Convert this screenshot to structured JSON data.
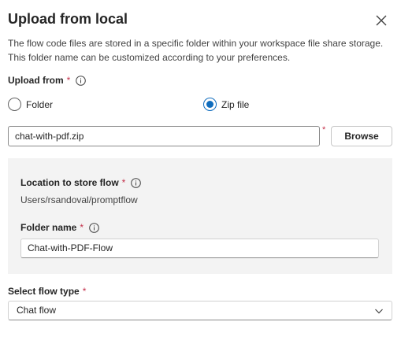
{
  "dialog": {
    "title": "Upload from local",
    "description": "The flow code files are stored in a specific folder within your workspace file share storage. This folder name can be customized according to your preferences."
  },
  "upload_from": {
    "label": "Upload from",
    "required_mark": "*",
    "options": [
      {
        "label": "Folder",
        "selected": false
      },
      {
        "label": "Zip file",
        "selected": true
      }
    ]
  },
  "file": {
    "value": "chat-with-pdf.zip",
    "required_mark": "*",
    "browse_label": "Browse"
  },
  "location": {
    "label": "Location to store flow",
    "required_mark": "*",
    "path": "Users/rsandoval/promptflow"
  },
  "folder_name": {
    "label": "Folder name",
    "required_mark": "*",
    "value": "Chat-with-PDF-Flow"
  },
  "flow_type": {
    "label": "Select flow type",
    "required_mark": "*",
    "selected": "Chat flow"
  },
  "colors": {
    "accent": "#0f6cbd",
    "required": "#c4314b",
    "panel_bg": "#f3f3f3"
  },
  "icons": [
    "close-icon",
    "info-icon",
    "chevron-down-icon"
  ]
}
